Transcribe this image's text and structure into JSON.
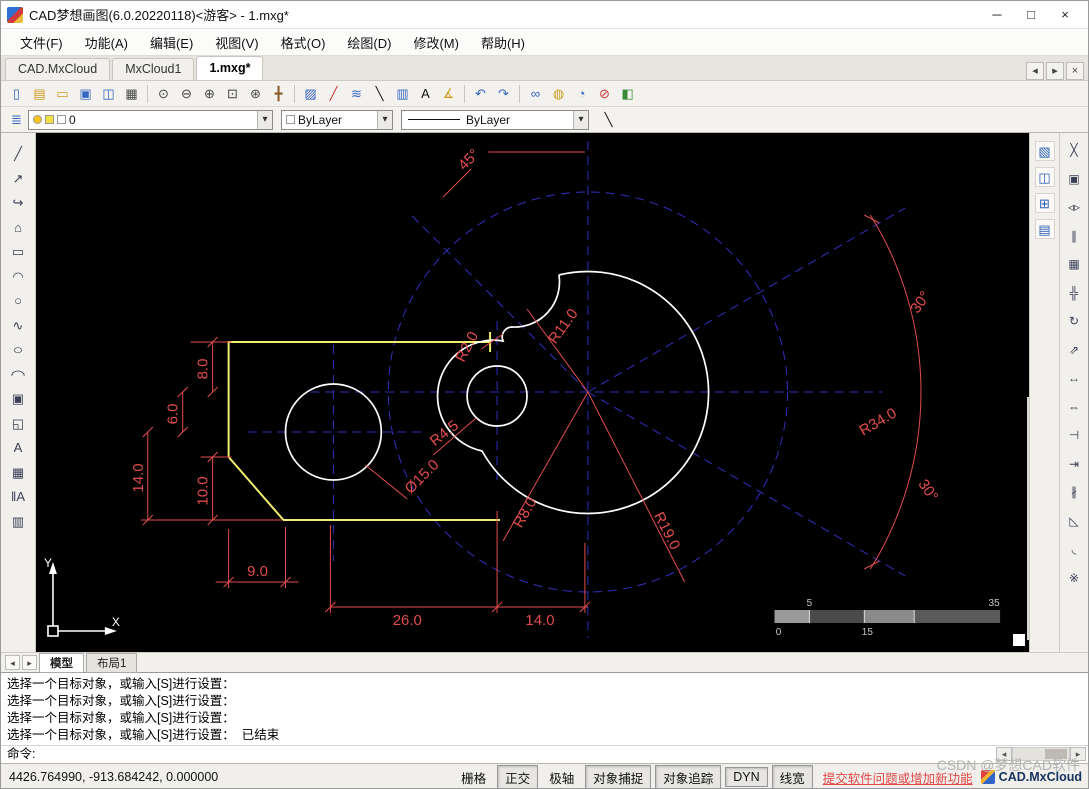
{
  "window": {
    "title": "CAD梦想画图(6.0.20220118)<游客> - 1.mxg*"
  },
  "menu": {
    "items": [
      "文件(F)",
      "功能(A)",
      "编辑(E)",
      "视图(V)",
      "格式(O)",
      "绘图(D)",
      "修改(M)",
      "帮助(H)"
    ]
  },
  "doc_tabs": {
    "tabs": [
      "CAD.MxCloud",
      "MxCloud1",
      "1.mxg*"
    ],
    "active": "1.mxg*"
  },
  "layer_bar": {
    "layer_value": "0",
    "color_value": "ByLayer",
    "linetype_value": "ByLayer"
  },
  "sheet_tabs": {
    "model": "模型",
    "layout1": "布局1"
  },
  "command": {
    "lines": [
      "选择一个目标对象，或输入[S]进行设置：",
      "选择一个目标对象，或输入[S]进行设置：",
      "选择一个目标对象，或输入[S]进行设置：",
      "选择一个目标对象，或输入[S]进行设置：  已结束"
    ],
    "prompt": "命令:"
  },
  "status": {
    "coords": "4426.764990, -913.684242, 0.000000",
    "toggles": [
      "栅格",
      "正交",
      "极轴",
      "对象捕捉",
      "对象追踪",
      "DYN",
      "线宽"
    ],
    "link": "提交软件问题或增加新功能",
    "brand": "CAD.MxCloud"
  },
  "watermark": "CSDN @梦想CAD软件",
  "drawing": {
    "labels": {
      "a45": "45°",
      "a30_top": "30°",
      "a30_bottom": "30°",
      "r2": "R2.0",
      "r11": "R11.0",
      "r45": "R4.5",
      "d15": "Ø15.0",
      "r8": "R8.0",
      "r19": "R19.0",
      "r34": "R34.0",
      "h8": "8.0",
      "h6": "6.0",
      "h14": "14.0",
      "h10": "10.0",
      "w9": "9.0",
      "w26": "26.0",
      "w14": "14.0"
    },
    "colors": {
      "dimension": "#e34c4c",
      "centerline": "#3030c0",
      "geometry": "#ffffff",
      "plate": "#f0ee6e"
    },
    "ucs": {
      "x": "X",
      "y": "Y"
    },
    "ruler": {
      "top_left": "5",
      "top_right": "35",
      "bottom_left": "0",
      "bottom_mid": "15"
    }
  },
  "icons": {
    "minimize": "─",
    "maximize": "□",
    "close": "×",
    "tab_prev": "◂",
    "tab_next": "▸",
    "tab_close": "×",
    "dropdown": "▾",
    "new_file": "▯",
    "open_template": "▤",
    "open_file": "▭",
    "save": "▣",
    "save_as": "◫",
    "plot": "▦",
    "zoom_prev": "⊙",
    "zoom_out": "⊖",
    "zoom_in": "⊕",
    "zoom_window": "⊡",
    "zoom_extents": "⊛",
    "pan": "╋",
    "draw_color": "▨",
    "pencil": "╱",
    "palette": "≋",
    "brush": "╲",
    "table": "▥",
    "text_edit": "A",
    "angle": "∡",
    "undo": "↶",
    "redo": "↷",
    "hyperlink": "∞",
    "web": "◍",
    "cloud": "◔",
    "stop": "⊘",
    "image": "◧",
    "layers": "≣",
    "match_brush": "╲",
    "line": "╱",
    "xline": "↗",
    "polyline": "↪",
    "polygon": "⌂",
    "rectangle": "▭",
    "arc": "◠",
    "circle": "○",
    "spline": "∿",
    "ellipse": "○",
    "ellipse_arc": "◠",
    "block": "▣",
    "region": "◱",
    "text": "A",
    "hatch": "▦",
    "mtext": "‖A",
    "table2": "▥",
    "vp1": "▧",
    "vp2": "◫",
    "vp3": "⊞",
    "vp4": "▤",
    "erase": "╳",
    "copy": "▣",
    "mirror": "◃▹",
    "offset": "∥",
    "array": "▦",
    "move": "╬",
    "rotate": "↻",
    "scale": "⇗",
    "stretch": "↔",
    "lengthen": "⇔",
    "trim": "⊣",
    "extend": "⇥",
    "break": "∦",
    "chamfer": "◺",
    "fillet": "◟",
    "explode": "※",
    "sheet_prev": "◂",
    "sheet_next": "▸",
    "cmd_left": "◂",
    "cmd_right": "▸"
  }
}
